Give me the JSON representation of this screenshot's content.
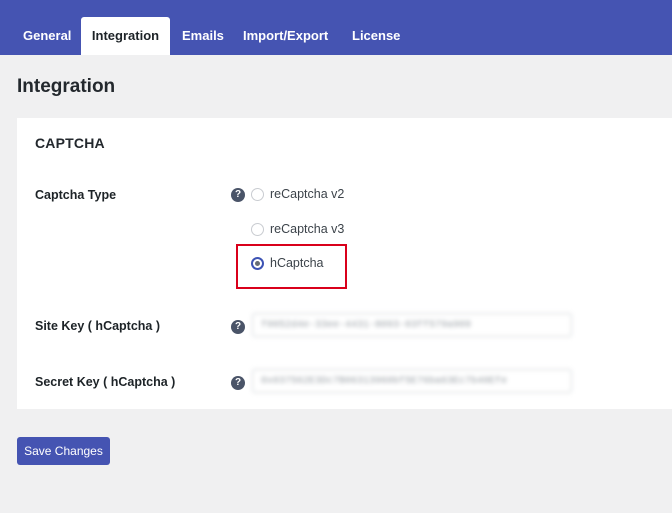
{
  "tabs": [
    {
      "label": "General",
      "active": false
    },
    {
      "label": "Integration",
      "active": true
    },
    {
      "label": "Emails",
      "active": false
    },
    {
      "label": "Import/Export",
      "active": false
    },
    {
      "label": "License",
      "active": false
    }
  ],
  "page": {
    "title": "Integration"
  },
  "captcha": {
    "section_title": "CAPTCHA",
    "type_label": "Captcha Type",
    "help_glyph": "?",
    "options": [
      {
        "label": "reCaptcha v2",
        "checked": false
      },
      {
        "label": "reCaptcha v3",
        "checked": false
      },
      {
        "label": "hCaptcha",
        "checked": true
      }
    ],
    "site_key": {
      "label": "Site Key ( hCaptcha )",
      "value": "f0052d4e-33ee-4431-8093-03ff579a909"
    },
    "secret_key": {
      "label": "Secret Key ( hCaptcha )",
      "value": "0x037562E3Dc7B06313960bf5E76ba63Ec7b40Efe"
    }
  },
  "save_button": {
    "label": "Save Changes"
  },
  "colors": {
    "accent": "#4554b2",
    "highlight": "#d9001b",
    "background": "#f0f0f1",
    "panel": "#ffffff",
    "help_icon": "#4a5468"
  }
}
